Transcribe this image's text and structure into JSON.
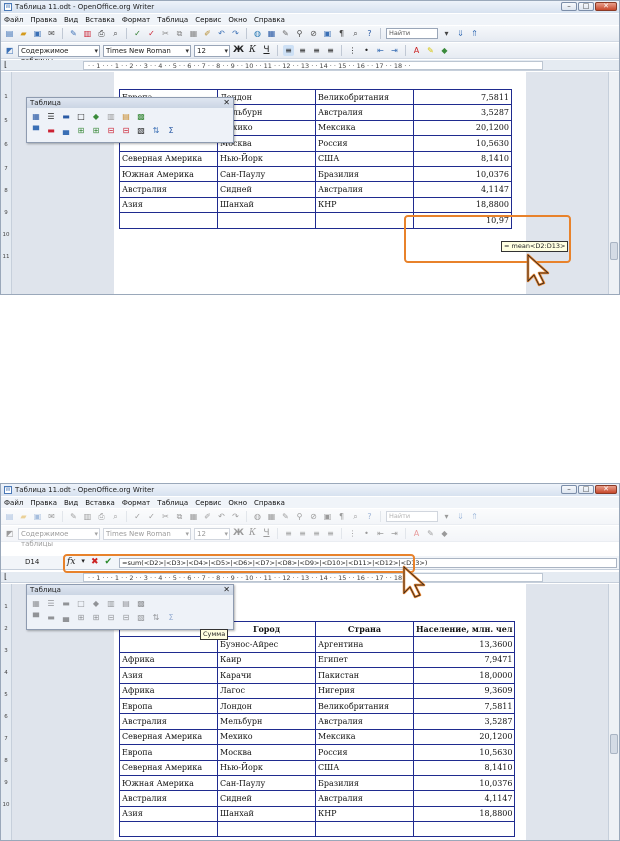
{
  "window": {
    "title": "Таблица 11.odt - OpenOffice.org Writer",
    "min": "–",
    "max": "□",
    "close": "✕"
  },
  "menu": [
    "Файл",
    "Правка",
    "Вид",
    "Вставка",
    "Формат",
    "Таблица",
    "Сервис",
    "Окно",
    "Справка"
  ],
  "toolbar": {
    "style_value": "Содержимое таблицы",
    "font_value": "Times New Roman",
    "size_value": "12",
    "bold": "Ж",
    "italic": "К",
    "underline": "Ч",
    "find_placeholder": "Найти"
  },
  "ruler_text": "· · 1 · · · 1 · · 2 · · 3 · · 4 · · 5 · · 6 · · 7 · · 8 · · 9 · · 10 · · 11 · · 12 · · 13 · · 14 · · 15 · · 16 · · 17 · · 18 · ·",
  "vruler1": [
    "1",
    "5",
    "6",
    "7",
    "8",
    "9",
    "10",
    "11",
    "12"
  ],
  "vruler2": [
    "1",
    "2",
    "3",
    "4",
    "5",
    "6",
    "7",
    "8",
    "9",
    "10"
  ],
  "table_toolbar": {
    "title": "Таблица",
    "close": "✕"
  },
  "top": {
    "rows": [
      [
        "Европа",
        "Лондон",
        "Великобритания",
        "7,5811"
      ],
      [
        "",
        "Мельбурн",
        "Австралия",
        "3,5287"
      ],
      [
        "",
        "Мехико",
        "Мексика",
        "20,1200"
      ],
      [
        "",
        "Москва",
        "Россия",
        "10,5630"
      ],
      [
        "Северная Америка",
        "Нью-Йорк",
        "США",
        "8,1410"
      ],
      [
        "Южная Америка",
        "Сан-Паулу",
        "Бразилия",
        "10,0376"
      ],
      [
        "Австралия",
        "Сидней",
        "Австралия",
        "4,1147"
      ],
      [
        "Азия",
        "Шанхай",
        "КНР",
        "18,8800"
      ],
      [
        "",
        "",
        "",
        "10,97"
      ]
    ],
    "tooltip": "= mean<D2:D13>"
  },
  "bottom": {
    "cell_ref": "D14",
    "fx": "fx",
    "formula": "=sum(<D2>|<D3>|<D4>|<D5>|<D6>|<D7>|<D8>|<D9>|<D10>|<D11>|<D12>|<D13>)",
    "headers": [
      "",
      "Город",
      "Страна",
      "Население, млн. чел"
    ],
    "rows": [
      [
        "",
        "Буэнос-Айрес",
        "Аргентина",
        "13,3600"
      ],
      [
        "Африка",
        "Каир",
        "Египет",
        "7,9471"
      ],
      [
        "Азия",
        "Карачи",
        "Пакистан",
        "18,0000"
      ],
      [
        "Африка",
        "Лагос",
        "Нигерия",
        "9,3609"
      ],
      [
        "Европа",
        "Лондон",
        "Великобритания",
        "7,5811"
      ],
      [
        "Австралия",
        "Мельбурн",
        "Австралия",
        "3,5287"
      ],
      [
        "Северная Америка",
        "Мехико",
        "Мексика",
        "20,1200"
      ],
      [
        "Европа",
        "Москва",
        "Россия",
        "10,5630"
      ],
      [
        "Северная Америка",
        "Нью-Йорк",
        "США",
        "8,1410"
      ],
      [
        "Южная Америка",
        "Сан-Паулу",
        "Бразилия",
        "10,0376"
      ],
      [
        "Австралия",
        "Сидней",
        "Австралия",
        "4,1147"
      ],
      [
        "Азия",
        "Шанхай",
        "КНР",
        "18,8800"
      ],
      [
        "",
        "",
        "",
        ""
      ]
    ],
    "tooltip": "Сумма"
  },
  "colors": {
    "highlight": "#e8822b",
    "table_border": "#1f2b8f"
  }
}
